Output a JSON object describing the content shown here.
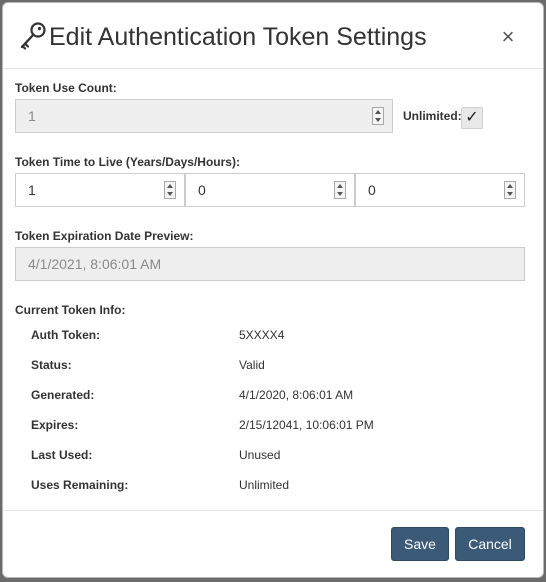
{
  "dialog": {
    "title": "Edit Authentication Token Settings",
    "close_glyph": "×",
    "icon": "key-icon"
  },
  "use_count": {
    "label": "Token Use Count:",
    "value": "1",
    "disabled": true,
    "unlimited_label": "Unlimited:",
    "unlimited_checked": true,
    "check_glyph": "✓"
  },
  "ttl": {
    "label": "Token Time to Live (Years/Days/Hours):",
    "years": "1",
    "days": "0",
    "hours": "0"
  },
  "expiration_preview": {
    "label": "Token Expiration Date Preview:",
    "value": "4/1/2021, 8:06:01 AM"
  },
  "current_info": {
    "label": "Current Token Info:",
    "rows": [
      {
        "key": "Auth Token:",
        "value": "5XXXX4"
      },
      {
        "key": "Status:",
        "value": "Valid"
      },
      {
        "key": "Generated:",
        "value": "4/1/2020, 8:06:01 AM"
      },
      {
        "key": "Expires:",
        "value": "2/15/12041, 10:06:01 PM"
      },
      {
        "key": "Last Used:",
        "value": "Unused"
      },
      {
        "key": "Uses Remaining:",
        "value": "Unlimited"
      }
    ]
  },
  "footer": {
    "save_label": "Save",
    "cancel_label": "Cancel"
  },
  "colors": {
    "primary_button": "#3a5a78",
    "disabled_field": "#eeeeee",
    "overlay": "#6b6b6b"
  }
}
